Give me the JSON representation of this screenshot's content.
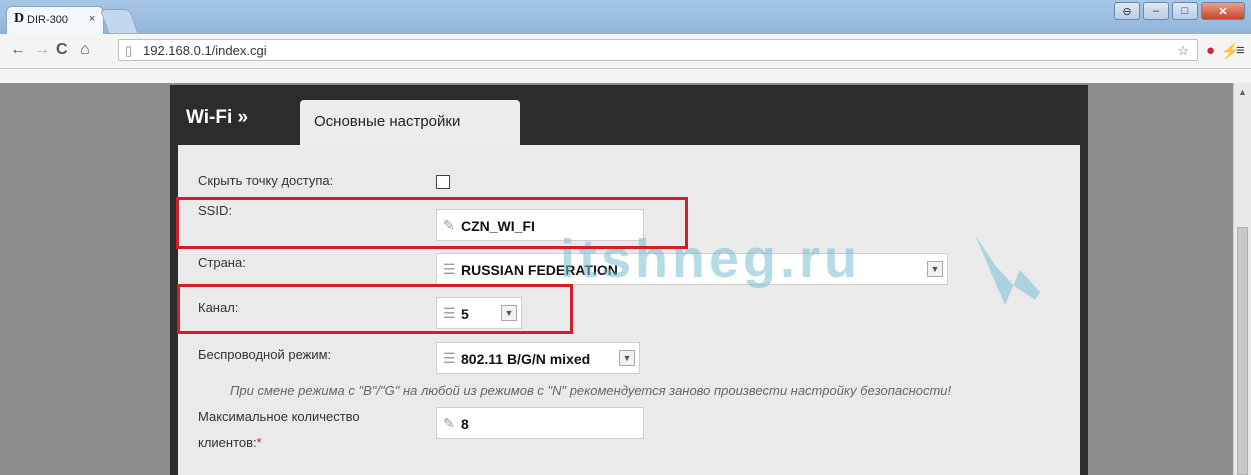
{
  "browser": {
    "tab_logo": "D",
    "tab_title": "DIR-300",
    "tab_close": "×",
    "url": "192.168.0.1/index.cgi",
    "window_buttons": [
      "⊖",
      "–",
      "□",
      "✕"
    ]
  },
  "header": {
    "title": "Wi-Fi »",
    "tab_label": "Основные настройки"
  },
  "form": {
    "hide_ap_label": "Скрыть точку доступа:",
    "ssid_label": "SSID:",
    "ssid_value": "CZN_WI_FI",
    "country_label": "Страна:",
    "country_value": "RUSSIAN FEDERATION",
    "channel_label": "Канал:",
    "channel_value": "5",
    "mode_label": "Беспроводной режим:",
    "mode_value": "802.11 B/G/N mixed",
    "note": "При смене режима с \"B\"/\"G\" на любой из режимов с \"N\" рекомендуется заново произвести настройку безопасности!",
    "max_clients_label_1": "Максимальное количество",
    "max_clients_label_2": "клиентов:",
    "required_mark": "*",
    "max_clients_value": "8"
  },
  "watermark": {
    "text": "itshneg.ru"
  },
  "colors": {
    "highlight": "#d11f2a",
    "header_bg": "#2c2c2c",
    "content_bg": "#eaeaea"
  }
}
